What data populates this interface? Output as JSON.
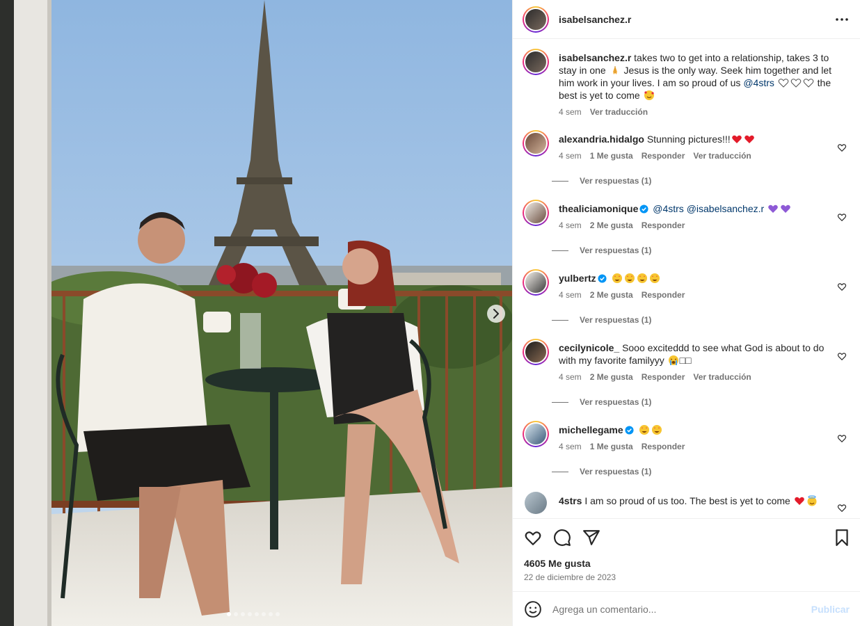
{
  "post": {
    "author": "isabelsanchez.r",
    "caption": {
      "text_1": " takes two to get into a relationship, takes 3 to stay in one ",
      "text_2": " Jesus is the only way. Seek him together and let him work in your lives. I am so proud of us ",
      "mention": "@4strs",
      "text_3": " the best is yet to come ",
      "time": "4 sem",
      "translate": "Ver traducción"
    },
    "likes": "4605 Me gusta",
    "date": "22 de diciembre de 2023",
    "carousel": {
      "slides": 8,
      "current": 1
    }
  },
  "comments": [
    {
      "user": "alexandria.hidalgo",
      "verified": false,
      "text": "Stunning pictures!!!",
      "emojis": [
        "red-heart",
        "red-heart"
      ],
      "time": "4 sem",
      "likes": "1 Me gusta",
      "reply": "Responder",
      "translate": "Ver traducción",
      "replies": "Ver respuestas (1)"
    },
    {
      "user": "thealiciamonique",
      "verified": true,
      "mentions": "@4strs @isabelsanchez.r",
      "emojis": [
        "purple-heart",
        "purple-heart"
      ],
      "time": "4 sem",
      "likes": "2 Me gusta",
      "reply": "Responder",
      "replies": "Ver respuestas (1)"
    },
    {
      "user": "yulbertz",
      "verified": true,
      "emojis": [
        "star-eyes",
        "star-eyes",
        "star-eyes",
        "star-eyes"
      ],
      "time": "4 sem",
      "likes": "2 Me gusta",
      "reply": "Responder",
      "replies": "Ver respuestas (1)"
    },
    {
      "user": "cecilynicole_",
      "verified": false,
      "text": "Sooo exciteddd to see what God is about to do with my favorite familyyy ",
      "emojis": [
        "crying-face"
      ],
      "trail": "□□",
      "time": "4 sem",
      "likes": "2 Me gusta",
      "reply": "Responder",
      "translate": "Ver traducción",
      "replies": "Ver respuestas (1)"
    },
    {
      "user": "michellegame",
      "verified": true,
      "emojis": [
        "star-eyes",
        "star-eyes"
      ],
      "time": "4 sem",
      "likes": "1 Me gusta",
      "reply": "Responder",
      "replies": "Ver respuestas (1)"
    },
    {
      "user": "4strs",
      "verified": false,
      "text": "I am so proud of us too. The best is yet to come ",
      "emojis": [
        "red-heart",
        "smiling-halo"
      ]
    }
  ],
  "composer": {
    "placeholder": "Agrega un comentario...",
    "publish": "Publicar"
  },
  "colors": {
    "link": "#00376b",
    "muted": "#737373",
    "publish_disabled": "#c7e0fd",
    "verified": "#0095f6",
    "text": "#262626"
  },
  "icons": {
    "more": "more-horizontal-icon",
    "like": "heart-outline-icon",
    "comment": "comment-bubble-icon",
    "share": "paper-plane-icon",
    "save": "bookmark-icon",
    "emoji": "smiley-icon",
    "next": "chevron-right-icon"
  }
}
